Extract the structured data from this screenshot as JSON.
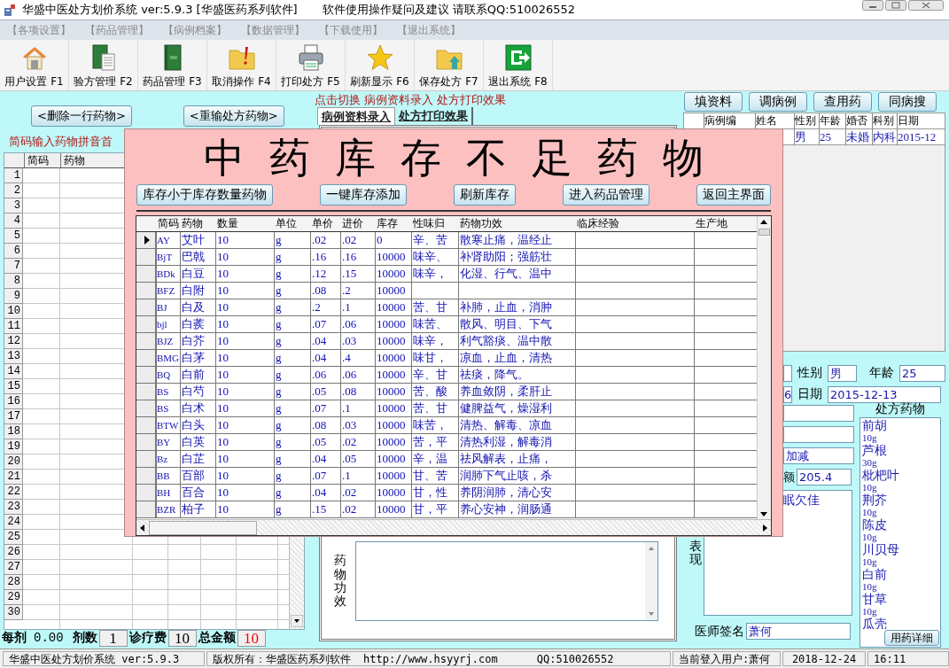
{
  "window": {
    "title": "华盛中医处方划价系统 ver:5.9.3  [华盛医药系列软件]",
    "notice": "软件使用操作疑问及建议 请联系QQ:510026552"
  },
  "menu": [
    "【各项设置】",
    "【药品管理】",
    "【病例档案】",
    "【数据管理】",
    "【下载使用】",
    "【退出系统】"
  ],
  "toolbar": [
    "用户设置 F1",
    "验方管理 F2",
    "药品管理 F3",
    "取消操作 F4",
    "打印处方 F5",
    "刷新显示 F6",
    "保存处方 F7",
    "退出系统 F8"
  ],
  "left": {
    "buttons": [
      "<删除一行药物>",
      "<重输处方药物>"
    ],
    "hint": "简码输入药物拼音首",
    "grid": {
      "columns": [
        "简码",
        "药物"
      ],
      "row_numbers": [
        "1",
        "2",
        "3",
        "4",
        "5",
        "6",
        "7",
        "8",
        "9",
        "10",
        "11",
        "12",
        "13",
        "14",
        "15",
        "16",
        "17",
        "18",
        "19",
        "20",
        "21",
        "22",
        "23",
        "24",
        "25",
        "26",
        "27",
        "28",
        "29",
        "30"
      ]
    },
    "summary": [
      {
        "label": "每剂",
        "value": "0.00",
        "color": "#000000"
      },
      {
        "label": "剂数",
        "value": "1",
        "color": "#000000"
      },
      {
        "label": "诊疗费",
        "value": "10",
        "color": "#000000"
      },
      {
        "label": "总金额",
        "value": "10",
        "color": "#ff0000"
      }
    ]
  },
  "switch_hint": "点击切换  病例资料录入  处方打印效果",
  "tabs": [
    {
      "label": "病例资料录入",
      "selected": true
    },
    {
      "label": "处方打印效果",
      "selected": false
    }
  ],
  "efficacy_label": "药物功效",
  "right": {
    "buttons": [
      "填资料",
      "调病例",
      "查用药",
      "同病搜"
    ],
    "patients": {
      "columns": [
        "病例编",
        "姓名",
        "性别",
        "年龄",
        "婚否",
        "科别",
        "日期"
      ],
      "row": [
        "男",
        "25",
        "未婚",
        "内科",
        "2015-12"
      ]
    },
    "form": {
      "sex_label": "性别",
      "sex": "男",
      "age_label": "年龄",
      "age": "25",
      "id_tail": "6",
      "date_label": "日期",
      "date": "2015-12-13",
      "formula": "加减",
      "amount_label": "额",
      "amount": "205.4",
      "symptoms": "眠欠佳",
      "symptoms_label": "表现",
      "doctor_label": "医师签名",
      "doctor": "萧何"
    },
    "prescription": {
      "title": "处方药物",
      "items": [
        {
          "name": "前胡",
          "dose": "10g"
        },
        {
          "name": "芦根",
          "dose": "30g"
        },
        {
          "name": "枇杷叶",
          "dose": "10g"
        },
        {
          "name": "荆芥",
          "dose": "10g"
        },
        {
          "name": "陈皮",
          "dose": "10g"
        },
        {
          "name": "川贝母",
          "dose": "10g"
        },
        {
          "name": "白前",
          "dose": "10g"
        },
        {
          "name": "甘草",
          "dose": "10g"
        },
        {
          "name": "瓜壳"
        }
      ],
      "button": "用药详细"
    }
  },
  "dialog": {
    "title": "中药库存不足药物",
    "buttons": [
      "库存小于库存数量药物",
      "一键库存添加",
      "刷新库存",
      "进入药品管理",
      "返回主界面"
    ],
    "table": {
      "columns": [
        "简码",
        "药物",
        "数量",
        "单位",
        "单价",
        "进价",
        "库存",
        "性味归",
        "药物功效",
        "临床经验",
        "生产地"
      ],
      "rows": [
        {
          "selected": true,
          "cells": [
            "AY",
            "艾叶",
            "10",
            "g",
            ".02",
            ".02",
            "0",
            "辛、苦",
            "散寒止痛，温经止"
          ]
        },
        {
          "selected": false,
          "cells": [
            "BjT",
            "巴戟",
            "10",
            "g",
            ".16",
            ".16",
            "10000",
            "味辛、",
            "补肾助阳；强筋壮"
          ]
        },
        {
          "selected": false,
          "cells": [
            "BDk",
            "白豆",
            "10",
            "g",
            ".12",
            ".15",
            "10000",
            "味辛，",
            "化湿、行气、温中"
          ]
        },
        {
          "selected": false,
          "cells": [
            "BFZ",
            "白附",
            "10",
            "g",
            ".08",
            ".2",
            "10000",
            "",
            ""
          ]
        },
        {
          "selected": false,
          "cells": [
            "BJ",
            "白及",
            "10",
            "g",
            ".2",
            ".1",
            "10000",
            "苦、甘",
            "补肺，止血，消肿"
          ]
        },
        {
          "selected": false,
          "cells": [
            "bjl",
            "白蒺",
            "10",
            "g",
            ".07",
            ".06",
            "10000",
            "味苦、",
            "散风、明目、下气"
          ]
        },
        {
          "selected": false,
          "cells": [
            "BJZ",
            "白芥",
            "10",
            "g",
            ".04",
            ".03",
            "10000",
            "味辛，",
            "利气豁痰、温中散"
          ]
        },
        {
          "selected": false,
          "cells": [
            "BMG",
            "白茅",
            "10",
            "g",
            ".04",
            ".4",
            "10000",
            "味甘，",
            "凉血，止血，清热"
          ]
        },
        {
          "selected": false,
          "cells": [
            "BQ",
            "白前",
            "10",
            "g",
            ".06",
            ".06",
            "10000",
            "辛、甘",
            "祛痰，降气。"
          ]
        },
        {
          "selected": false,
          "cells": [
            "BS",
            "白芍",
            "10",
            "g",
            ".05",
            ".08",
            "10000",
            "苦、酸",
            "养血敛阴，柔肝止"
          ]
        },
        {
          "selected": false,
          "cells": [
            "BS",
            "白术",
            "10",
            "g",
            ".07",
            ".1",
            "10000",
            "苦、甘",
            "健脾益气，燥湿利"
          ]
        },
        {
          "selected": false,
          "cells": [
            "BTW",
            "白头",
            "10",
            "g",
            ".08",
            ".03",
            "10000",
            "味苦，",
            "清热、解毒、凉血"
          ]
        },
        {
          "selected": false,
          "cells": [
            "BY",
            "白英",
            "10",
            "g",
            ".05",
            ".02",
            "10000",
            "苦，平",
            "清热利湿，解毒消"
          ]
        },
        {
          "selected": false,
          "cells": [
            "Bz",
            "白芷",
            "10",
            "g",
            ".04",
            ".05",
            "10000",
            "辛，温",
            "祛风解表，止痛，"
          ]
        },
        {
          "selected": false,
          "cells": [
            "BB",
            "百部",
            "10",
            "g",
            ".07",
            ".1",
            "10000",
            "甘、苦",
            "润肺下气止咳，杀"
          ]
        },
        {
          "selected": false,
          "cells": [
            "BH",
            "百合",
            "10",
            "g",
            ".04",
            ".02",
            "10000",
            "甘，性",
            "养阴润肺，清心安"
          ]
        },
        {
          "selected": false,
          "cells": [
            "BZR",
            "柏子",
            "10",
            "g",
            ".15",
            ".02",
            "10000",
            "甘，平",
            "养心安神，润肠通"
          ]
        }
      ]
    }
  },
  "status_bar": {
    "app": "华盛中医处方划价系统 ver:5.9.3",
    "copyright": "版权所有：华盛医药系列软件",
    "url": "http://www.hsyyrj.com",
    "qq": "QQ:510026552",
    "user": "当前登入用户:萧何",
    "date": "2018-12-24",
    "time": "16:11"
  }
}
